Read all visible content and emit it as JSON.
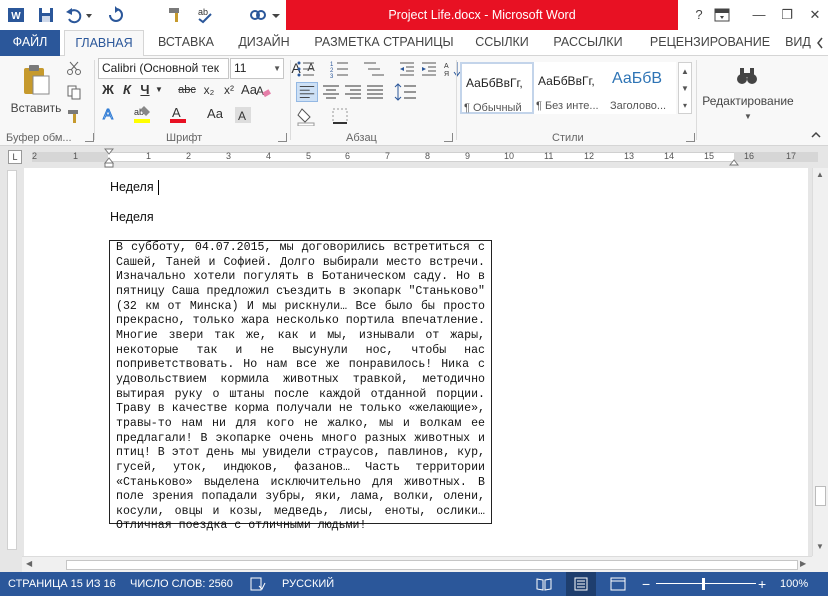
{
  "window": {
    "title": "Project Life.docx - Microsoft Word",
    "controls": {
      "help": "?",
      "minimize": "—",
      "restore": "❐",
      "close": "✕"
    }
  },
  "quick_access": [
    "word-icon",
    "save-icon",
    "undo-icon",
    "undo-dropdown-icon",
    "redo-icon",
    "brush-icon",
    "spellcheck-icon",
    "share-icon",
    "customize-icon"
  ],
  "tabs": [
    "ФАЙЛ",
    "ГЛАВНАЯ",
    "ВСТАВКА",
    "ДИЗАЙН",
    "РАЗМЕТКА СТРАНИЦЫ",
    "ССЫЛКИ",
    "РАССЫЛКИ",
    "РЕЦЕНЗИРОВАНИЕ",
    "ВИД"
  ],
  "active_tab": "ГЛАВНАЯ",
  "ribbon": {
    "clipboard": {
      "paste_label": "Вставить",
      "group": "Буфер обм..."
    },
    "font": {
      "font_name": "Calibri (Основной тек",
      "font_size": "11",
      "grow": "A",
      "shrink": "A",
      "case": "Aa",
      "bold": "Ж",
      "italic": "К",
      "underline": "Ч",
      "strike": "abc",
      "subscript": "x₂",
      "superscript": "x²",
      "group": "Шрифт"
    },
    "paragraph": {
      "pilcrow": "¶",
      "group": "Абзац"
    },
    "styles": {
      "items": [
        {
          "sample": "АаБбВвГг,",
          "name": "¶ Обычный"
        },
        {
          "sample": "АаБбВвГг,",
          "name": "¶ Без инте..."
        },
        {
          "sample": "АаБбВ",
          "name": "Заголово..."
        }
      ],
      "group": "Стили"
    },
    "editing": {
      "label": "Редактирование"
    }
  },
  "ruler": {
    "numbers": [
      "2",
      "1",
      "1",
      "2",
      "3",
      "4",
      "5",
      "6",
      "7",
      "8",
      "9",
      "10",
      "11",
      "12",
      "13",
      "14",
      "15",
      "16",
      "17"
    ]
  },
  "document": {
    "para1": "Неделя",
    "para2": "Неделя",
    "textbox_lines": [
      "В субботу, 04.07.2015, мы договорились встретиться с",
      "Сашей, Таней и Софией. Долго выбирали место встречи.",
      "Изначально хотели погулять в Ботаническом саду. Но в",
      "пятницу Саша предложил съездить в экопарк \"Станьково\"",
      "(32 км от Минска) И мы рискнули… Все было бы просто",
      "прекрасно, только жара несколько портила впечатление.",
      "Многие звери так же, как и мы, изнывали от жары,",
      "некоторые так и не высунули нос, чтобы нас",
      "поприветствовать. Но нам все же понравилось! Ника с",
      "удовольствием кормила животных травкой, методично",
      "вытирая руку о штаны после каждой отданной порции.",
      "Траву в качестве корма получали не только «желающие»,",
      "травы-то нам ни для кого не жалко, мы и волкам ее",
      "предлагали! В экопарке очень много разных животных и",
      "птиц! В этот день мы увидели страусов, павлинов, кур,",
      "гусей, уток, индюков, фазанов… Часть территории",
      "«Станьково» выделена исключительно для животных. В",
      "поле зрения попадали зубры, яки, лама, волки, олени,",
      "косули, овцы и козы, медведь, лисы, еноты, ослики…",
      "Отличная поездка с отличными людьми!"
    ]
  },
  "status": {
    "page": "СТРАНИЦА 15 ИЗ 16",
    "words": "ЧИСЛО СЛОВ: 2560",
    "language": "РУССКИЙ",
    "zoom": "100%",
    "zoom_minus": "−",
    "zoom_plus": "+"
  },
  "colors": {
    "accent": "#2b579a",
    "title_red": "#e81123"
  }
}
